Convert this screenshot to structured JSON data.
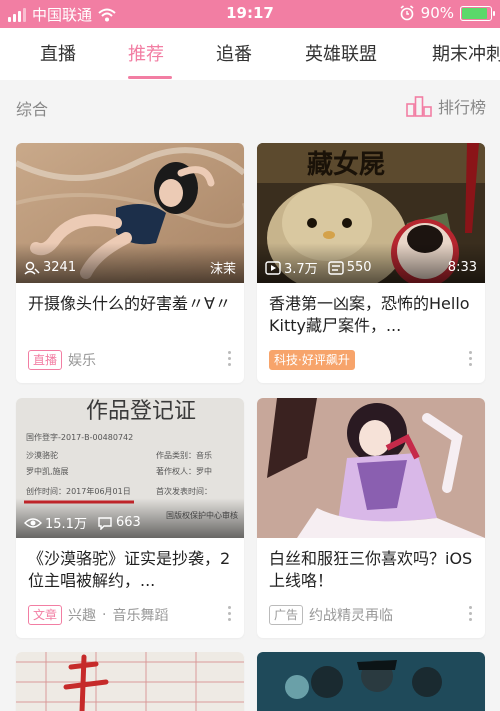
{
  "status": {
    "carrier": "中国联通",
    "time": "19:17",
    "battery": "90%",
    "battery_level": 0.9
  },
  "tabs": [
    {
      "label": "直播"
    },
    {
      "label": "推荐"
    },
    {
      "label": "追番"
    },
    {
      "label": "英雄联盟"
    },
    {
      "label": "期末冲刺"
    }
  ],
  "section": {
    "title": "综合",
    "rank_label": "排行榜"
  },
  "cards": [
    {
      "views": "3241",
      "uploader": "沫茉",
      "title": "开摄像头什么的好害羞〃∀〃",
      "badge": "直播",
      "category": "娱乐"
    },
    {
      "plays": "3.7万",
      "comments": "550",
      "duration": "8:33",
      "title": "香港第一凶案，恐怖的Hello Kitty藏尸案件，...",
      "badge": "科技·好评飙升"
    },
    {
      "views": "15.1万",
      "comments": "663",
      "title": "《沙漠骆驼》证实是抄袭，2位主唱被解约，...",
      "badge": "文章",
      "category": "兴趣",
      "sub": "音乐舞蹈"
    },
    {
      "title": "白丝和服狂三你喜欢吗？iOS上线咯！",
      "badge": "广告",
      "category": "约战精灵再临"
    }
  ],
  "colors": {
    "accent": "#f27ea3",
    "hot_badge": "#f7a46b"
  }
}
